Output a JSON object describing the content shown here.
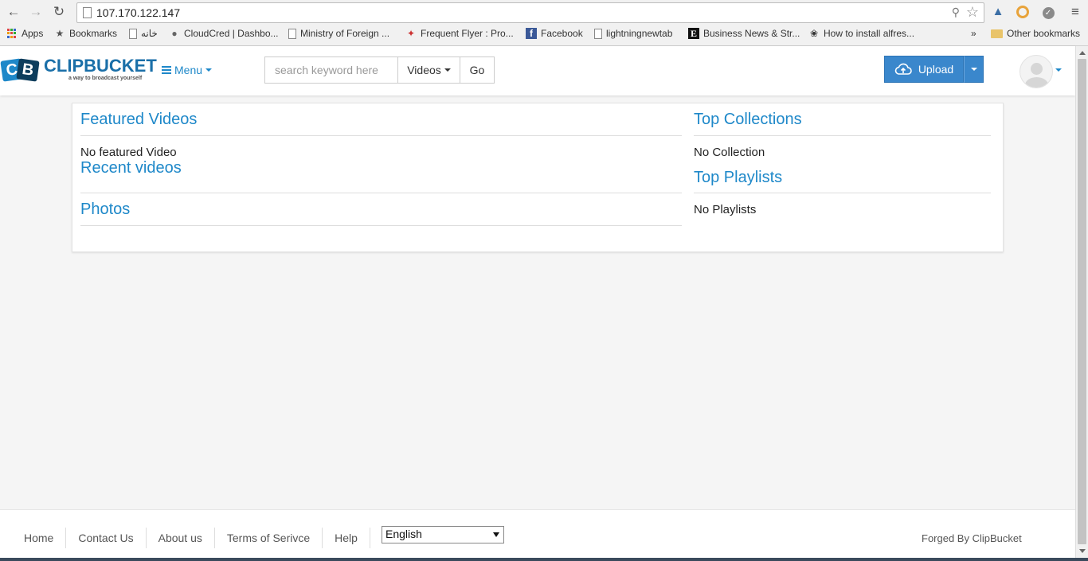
{
  "browser": {
    "url": "107.170.122.147",
    "bookmarks": [
      {
        "label": "Apps",
        "icon": "apps-grid-icon"
      },
      {
        "label": "Bookmarks",
        "icon": "star-icon"
      },
      {
        "label": "خانه",
        "icon": "page-icon"
      },
      {
        "label": "CloudCred | Dashbo...",
        "icon": "cloudcred-icon"
      },
      {
        "label": "Ministry of Foreign ...",
        "icon": "page-icon"
      },
      {
        "label": "Frequent Flyer : Pro...",
        "icon": "frequent-flyer-icon"
      },
      {
        "label": "Facebook",
        "icon": "facebook-icon"
      },
      {
        "label": "lightningnewtab",
        "icon": "page-icon"
      },
      {
        "label": "Business News & Str...",
        "icon": "business-news-icon"
      },
      {
        "label": "How to install alfres...",
        "icon": "bird-icon"
      }
    ],
    "overflow_label": "»",
    "other_bookmarks": "Other bookmarks"
  },
  "header": {
    "logo_text": "CLIPBUCKET",
    "logo_letters": {
      "c": "C",
      "b": "B"
    },
    "tagline": "a way to broadcast yourself",
    "menu_label": "Menu",
    "search": {
      "placeholder": "search keyword here",
      "type_label": "Videos",
      "go_label": "Go"
    },
    "upload_label": "Upload"
  },
  "main": {
    "featured_title": "Featured Videos",
    "featured_empty": "No featured Video",
    "recent_title": "Recent videos",
    "photos_title": "Photos",
    "collections_title": "Top Collections",
    "collections_empty": "No Collection",
    "playlists_title": "Top Playlists",
    "playlists_empty": "No Playlists"
  },
  "footer": {
    "links": [
      "Home",
      "Contact Us",
      "About us",
      "Terms of Serivce",
      "Help"
    ],
    "language": "English",
    "credit": "Forged By ClipBucket"
  },
  "colors": {
    "accent": "#1e88c9",
    "upload_button": "#3a87cc"
  }
}
